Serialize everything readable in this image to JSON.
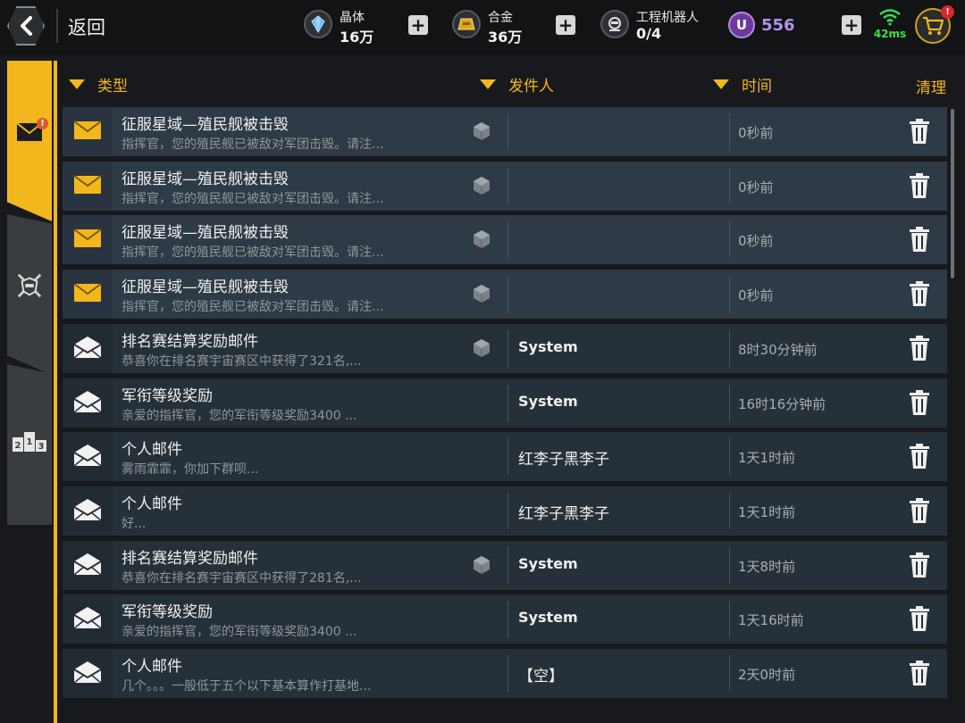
{
  "topbar": {
    "back_label": "返回",
    "resources": [
      {
        "name": "晶体",
        "value": "16万",
        "icon": "crystal-icon"
      },
      {
        "name": "合金",
        "value": "36万",
        "icon": "alloy-icon"
      },
      {
        "name": "工程机器人",
        "value": "0/4",
        "icon": "robot-icon"
      }
    ],
    "premium": {
      "symbol": "U",
      "value": "556",
      "color": "#b690e8"
    },
    "ping": "42ms",
    "cart_badge": "!"
  },
  "tabs": [
    {
      "name": "mail",
      "icon": "envelope-icon",
      "badge": "!",
      "active": true
    },
    {
      "name": "battle",
      "icon": "crossed-swords-icon",
      "active": false
    },
    {
      "name": "ranking",
      "icon": "podium-icon",
      "label": "2 1 3",
      "active": false
    }
  ],
  "header": {
    "type_label": "类型",
    "sender_label": "发件人",
    "time_label": "时间",
    "clear_label": "清理"
  },
  "mails": [
    {
      "title": "征服星域—殖民舰被击毁",
      "preview": "指挥官，您的殖民舰已被敌对军团击毁。请注...",
      "sender": "",
      "time": "0秒前",
      "unread": true,
      "attachment": true
    },
    {
      "title": "征服星域—殖民舰被击毁",
      "preview": "指挥官，您的殖民舰已被敌对军团击毁。请注...",
      "sender": "",
      "time": "0秒前",
      "unread": true,
      "attachment": true
    },
    {
      "title": "征服星域—殖民舰被击毁",
      "preview": "指挥官，您的殖民舰已被敌对军团击毁。请注...",
      "sender": "",
      "time": "0秒前",
      "unread": true,
      "attachment": true
    },
    {
      "title": "征服星域—殖民舰被击毁",
      "preview": "指挥官，您的殖民舰已被敌对军团击毁。请注...",
      "sender": "",
      "time": "0秒前",
      "unread": true,
      "attachment": true
    },
    {
      "title": "排名赛结算奖励邮件",
      "preview": "恭喜你在排名赛宇宙赛区中获得了321名,...",
      "sender": "System",
      "time": "8时30分钟前",
      "unread": false,
      "attachment": true
    },
    {
      "title": "军衔等级奖励",
      "preview": "亲爱的指挥官，您的军衔等级奖励3400 ...",
      "sender": "System",
      "time": "16时16分钟前",
      "unread": false,
      "attachment": false
    },
    {
      "title": "个人邮件",
      "preview": "雾雨霏霏，你加下群呗...",
      "sender": "红李子黑李子",
      "time": "1天1时前",
      "unread": false,
      "attachment": false
    },
    {
      "title": "个人邮件",
      "preview": "好...",
      "sender": "红李子黑李子",
      "time": "1天1时前",
      "unread": false,
      "attachment": false
    },
    {
      "title": "排名赛结算奖励邮件",
      "preview": "恭喜你在排名赛宇宙赛区中获得了281名,...",
      "sender": "System",
      "time": "1天8时前",
      "unread": false,
      "attachment": true
    },
    {
      "title": "军衔等级奖励",
      "preview": "亲爱的指挥官，您的军衔等级奖励3400 ...",
      "sender": "System",
      "time": "1天16时前",
      "unread": false,
      "attachment": false
    },
    {
      "title": "个人邮件",
      "preview": "几个。。。一般低于五个以下基本算作打基地...",
      "sender": "【空】",
      "time": "2天0时前",
      "unread": false,
      "attachment": false
    }
  ],
  "colors": {
    "accent": "#f2b71c",
    "badge": "#d9252b",
    "ping": "#39e04a"
  }
}
